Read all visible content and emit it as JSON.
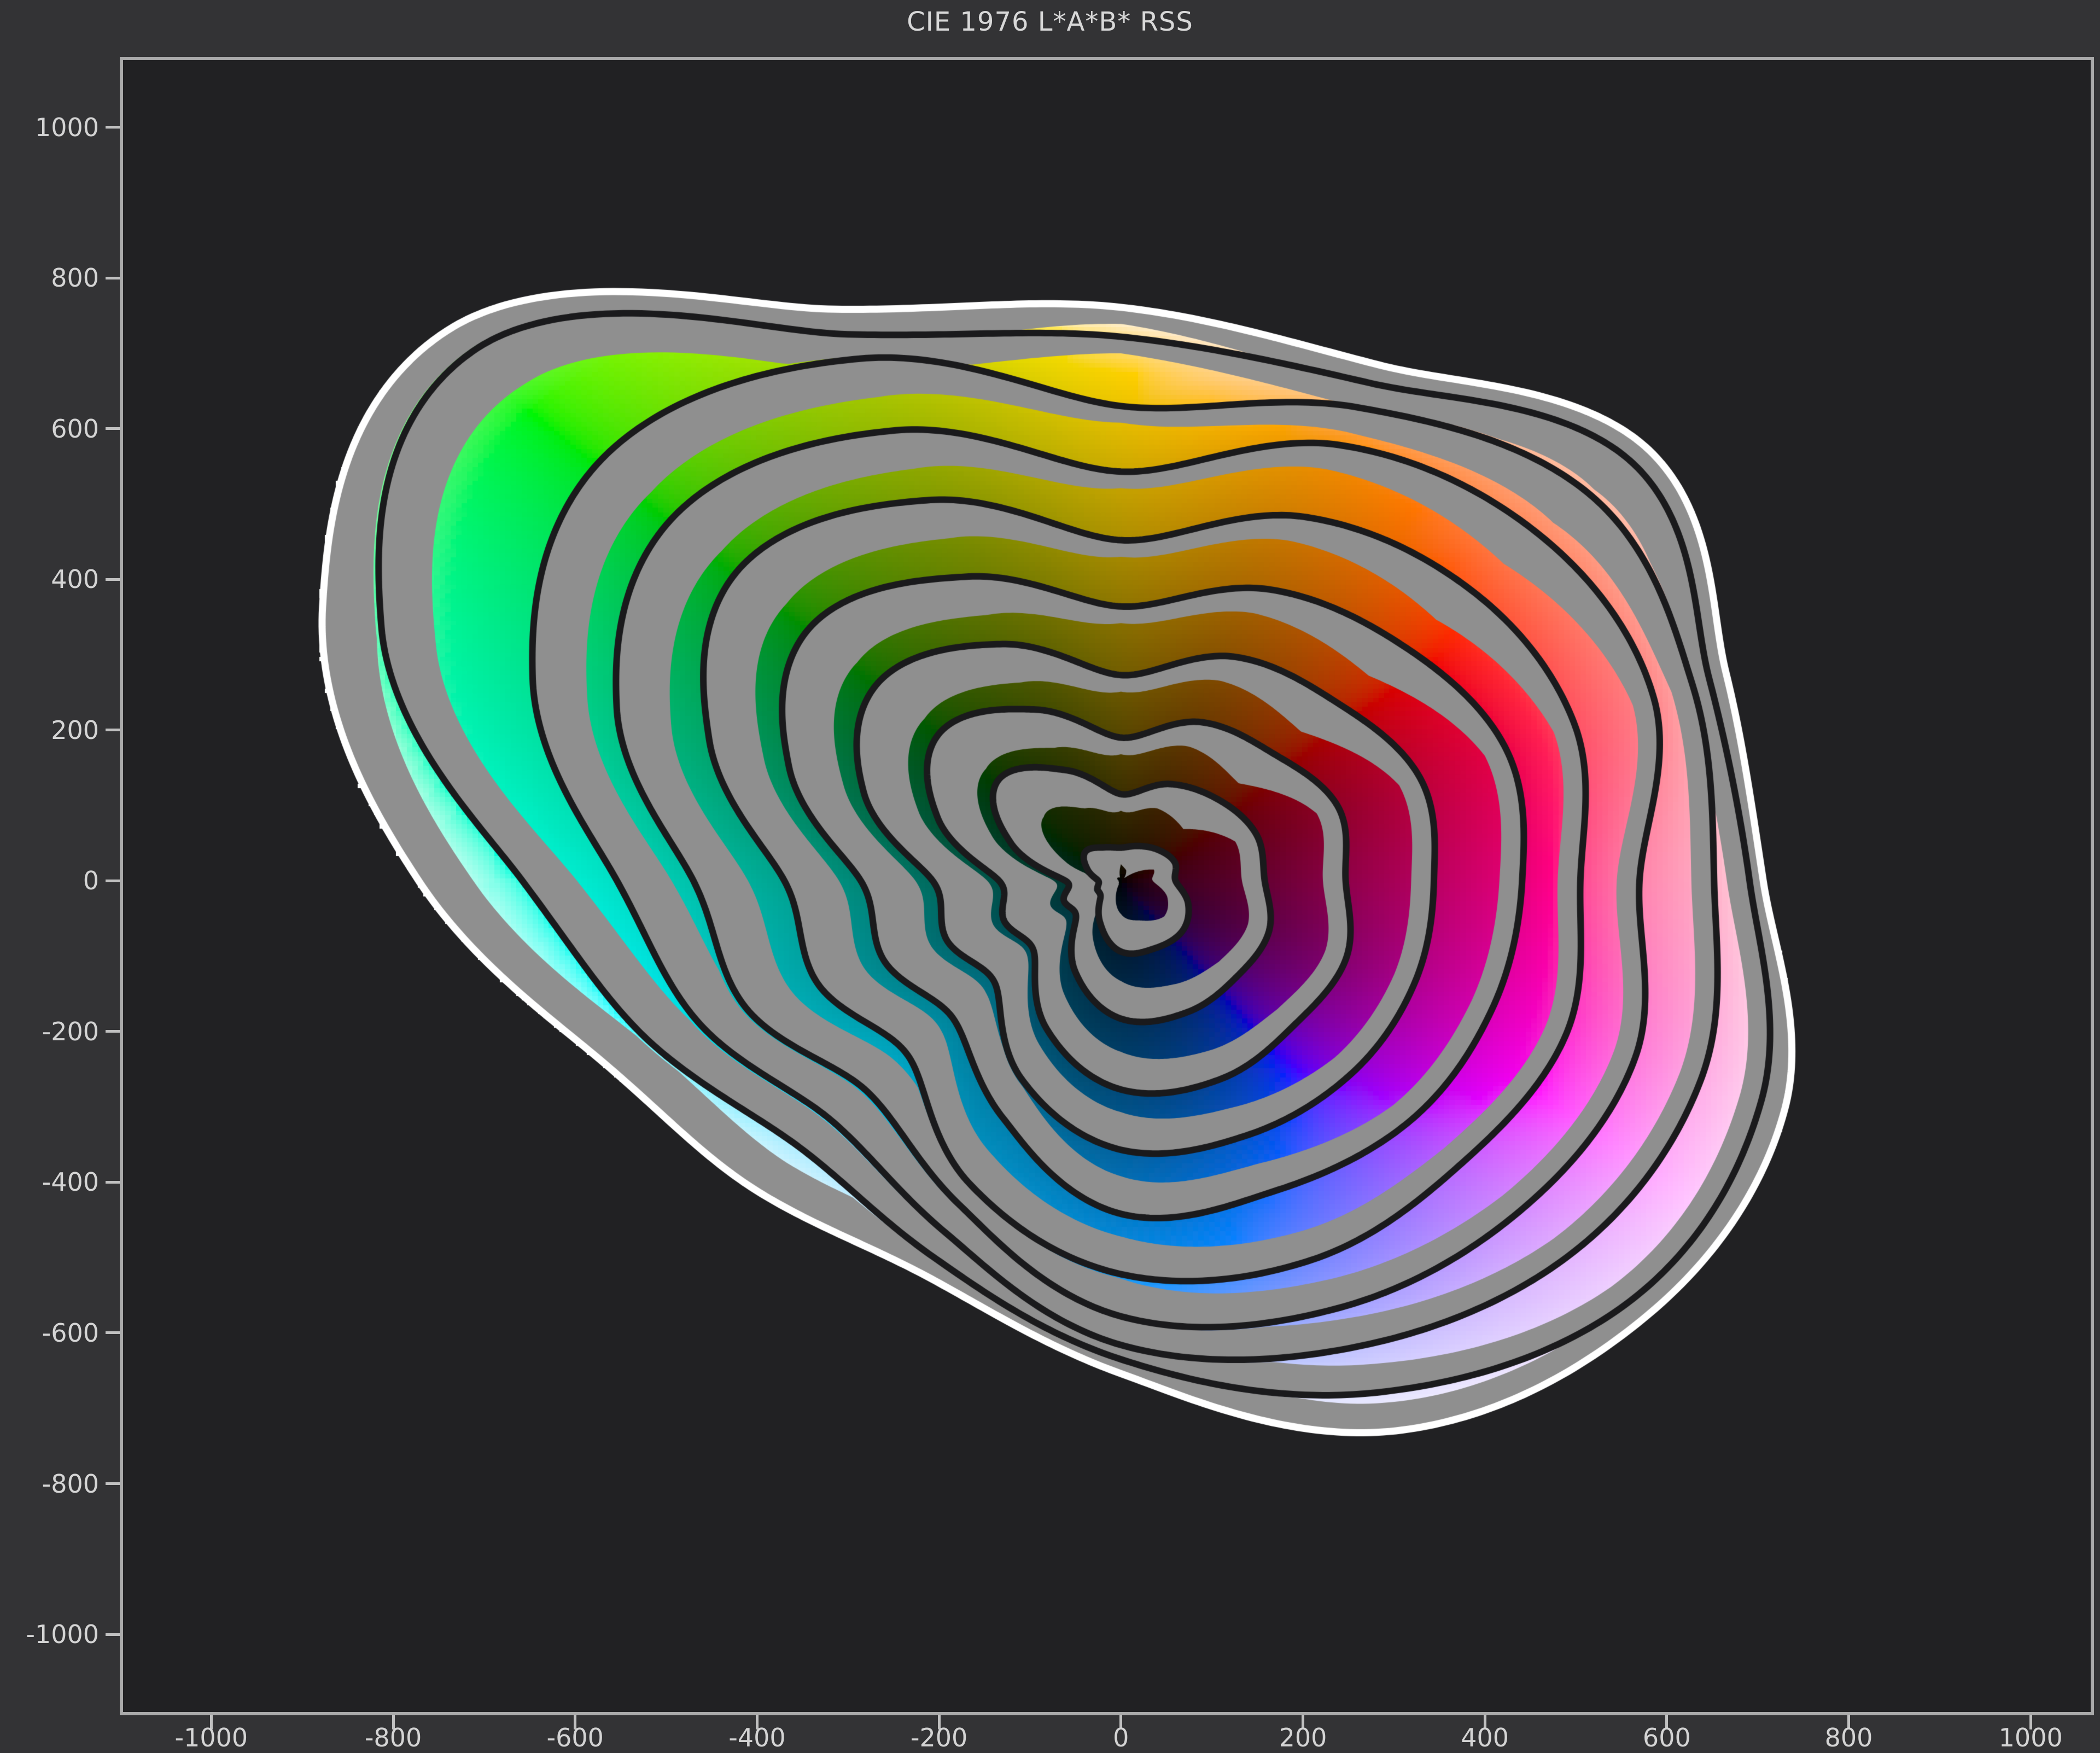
{
  "title": "CIE 1976 L*A*B* RSS",
  "colors": {
    "figure_bg": "#333335",
    "plot_bg": "#212123",
    "spine": "#aaaaaa",
    "tick_mark": "#c0c0c0",
    "tick_label": "#d4d4d4",
    "title_text": "#d8d8d8",
    "ring_line": "#1a1a1c",
    "outer_line": "#ffffff",
    "reference_gray": "#8f8f8f"
  },
  "chart_data": {
    "type": "gamut-rings",
    "title": "CIE 1976 L*A*B* RSS",
    "xlabel": "",
    "ylabel": "",
    "legend": null,
    "grid": false,
    "x_ticks": [
      -1000,
      -800,
      -600,
      -400,
      -200,
      0,
      200,
      400,
      600,
      800,
      1000
    ],
    "y_ticks": [
      -1000,
      -800,
      -600,
      -400,
      -200,
      0,
      200,
      400,
      600,
      800,
      1000
    ],
    "xlim": [
      -1097,
      1066
    ],
    "ylim": [
      -1103,
      1089
    ],
    "hue_mapping": "plot angle = CIELAB hue angle h(ab)",
    "lightness_mapping": "L* = 10 x ring index at each ring contour, interpolated radially, dark at center",
    "rings": {
      "L_values": [
        10,
        20,
        30,
        40,
        50,
        60,
        70,
        80,
        90,
        100
      ],
      "angles_deg": [
        0,
        22.5,
        45,
        67.5,
        90,
        112.5,
        135,
        157.5,
        180,
        202.5,
        225,
        247.5,
        270,
        292.5,
        315,
        337.5
      ],
      "radii": [
        [
          60,
          64,
          58,
          50,
          44,
          48,
          55,
          40,
          25,
          28,
          32,
          60,
          94,
          97,
          95,
          80
        ],
        [
          158,
          161,
          152,
          139,
          115,
          159,
          190,
          131,
          61,
          68,
          70,
          131,
          183,
          189,
          180,
          176
        ],
        [
          247,
          258,
          238,
          228,
          190,
          246,
          280,
          218,
          134,
          139,
          135,
          213,
          277,
          285,
          270,
          268
        ],
        [
          344,
          356,
          335,
          322,
          273,
          340,
          375,
          306,
          207,
          207,
          195,
          285,
          357,
          365,
          360,
          350
        ],
        [
          441,
          458,
          440,
          419,
          364,
          437,
          480,
          395,
          286,
          281,
          260,
          340,
          442,
          445,
          450,
          442
        ],
        [
          505,
          540,
          545,
          523,
          452,
          547,
          590,
          490,
          370,
          360,
          330,
          435,
          522,
          545,
          530,
          530
        ],
        [
          570,
          634,
          650,
          626,
          543,
          647,
          690,
          600,
          470,
          445,
          395,
          465,
          578,
          615,
          620,
          612
        ],
        [
          652,
          680,
          727,
          680,
          630,
          750,
          800,
          700,
          554,
          500,
          450,
          505,
          616,
          670,
          700,
          690
        ],
        [
          691,
          700,
          790,
          715,
          722,
          785,
          1000,
          880,
          658,
          560,
          500,
          540,
          635,
          735,
          790,
          762
        ],
        [
          706,
          720,
          815,
          741,
          761,
          821,
          1039,
          950,
          772,
          620,
          575,
          566,
          654,
          790,
          817,
          790
        ]
      ],
      "gray_gap_width": [
        25,
        25,
        55,
        35,
        22,
        55,
        70,
        65,
        60,
        55,
        50,
        50,
        50,
        40,
        28,
        25
      ]
    },
    "render": {
      "block_units": 6,
      "ring_line_width": 12,
      "outer_line_width": 13,
      "tick_len": 26
    }
  }
}
